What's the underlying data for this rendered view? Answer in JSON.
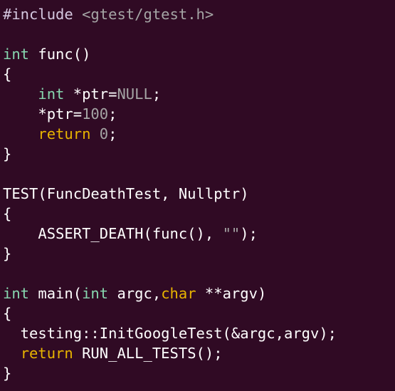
{
  "theme": {
    "background": "#300a24",
    "default_text": "#ffffff",
    "keyword": "#87d7af",
    "preprocessor": "#d5c8e0",
    "string": "#a5a5a5",
    "number": "#a5a5a5",
    "constant": "#a5a5a5",
    "control": "#e8b400"
  },
  "code": {
    "lines": [
      [
        {
          "t": "#include ",
          "c": "preproc"
        },
        {
          "t": "<gtest/gtest.h>",
          "c": "string"
        }
      ],
      [],
      [
        {
          "t": "int",
          "c": "keyword"
        },
        {
          "t": " func()",
          "c": "default"
        }
      ],
      [
        {
          "t": "{",
          "c": "default"
        }
      ],
      [
        {
          "t": "    ",
          "c": "default"
        },
        {
          "t": "int",
          "c": "keyword"
        },
        {
          "t": " *ptr=",
          "c": "default"
        },
        {
          "t": "NULL",
          "c": "const"
        },
        {
          "t": ";",
          "c": "default"
        }
      ],
      [
        {
          "t": "    *ptr=",
          "c": "default"
        },
        {
          "t": "100",
          "c": "number"
        },
        {
          "t": ";",
          "c": "default"
        }
      ],
      [
        {
          "t": "    ",
          "c": "default"
        },
        {
          "t": "return",
          "c": "control"
        },
        {
          "t": " ",
          "c": "default"
        },
        {
          "t": "0",
          "c": "number"
        },
        {
          "t": ";",
          "c": "default"
        }
      ],
      [
        {
          "t": "}",
          "c": "default"
        }
      ],
      [],
      [
        {
          "t": "TEST(FuncDeathTest, Nullptr)",
          "c": "default"
        }
      ],
      [
        {
          "t": "{",
          "c": "default"
        }
      ],
      [
        {
          "t": "    ASSERT_DEATH(func(), ",
          "c": "default"
        },
        {
          "t": "\"\"",
          "c": "string"
        },
        {
          "t": ");",
          "c": "default"
        }
      ],
      [
        {
          "t": "}",
          "c": "default"
        }
      ],
      [],
      [
        {
          "t": "int",
          "c": "keyword"
        },
        {
          "t": " main(",
          "c": "default"
        },
        {
          "t": "int",
          "c": "keyword"
        },
        {
          "t": " argc,",
          "c": "default"
        },
        {
          "t": "char",
          "c": "control"
        },
        {
          "t": " **argv)",
          "c": "default"
        }
      ],
      [
        {
          "t": "{",
          "c": "default"
        }
      ],
      [
        {
          "t": "  testing::InitGoogleTest(&argc,argv);",
          "c": "default"
        }
      ],
      [
        {
          "t": "  ",
          "c": "default"
        },
        {
          "t": "return",
          "c": "control"
        },
        {
          "t": " RUN_ALL_TESTS();",
          "c": "default"
        }
      ],
      [
        {
          "t": "}",
          "c": "default"
        }
      ]
    ]
  }
}
